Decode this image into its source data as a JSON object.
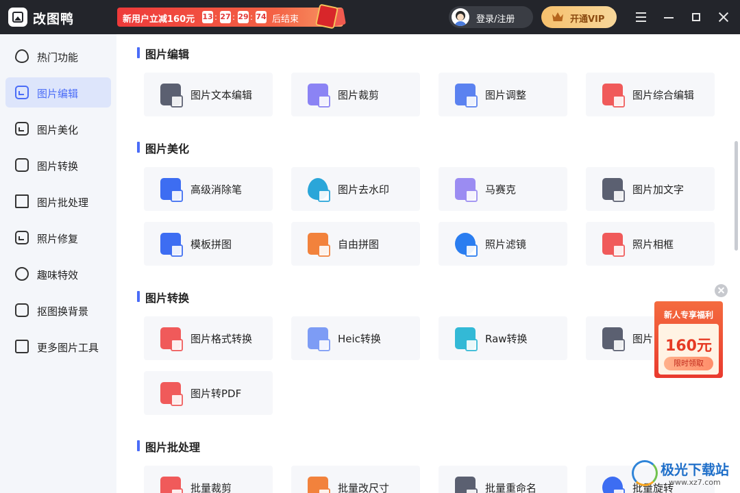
{
  "app": {
    "name": "改图鸭"
  },
  "promo": {
    "text": "新用户立减160元",
    "countdown": [
      "13",
      "27",
      "29",
      "74"
    ],
    "end_text": "后结束"
  },
  "header": {
    "login_label": "登录/注册",
    "vip_label": "开通VIP"
  },
  "sidebar": {
    "items": [
      {
        "label": "热门功能",
        "icon": "fire-icon"
      },
      {
        "label": "图片编辑",
        "icon": "image-edit-icon",
        "active": true
      },
      {
        "label": "图片美化",
        "icon": "image-beautify-icon"
      },
      {
        "label": "图片转换",
        "icon": "image-convert-icon"
      },
      {
        "label": "图片批处理",
        "icon": "batch-icon"
      },
      {
        "label": "照片修复",
        "icon": "photo-repair-icon"
      },
      {
        "label": "趣味特效",
        "icon": "magic-wand-icon"
      },
      {
        "label": "抠图换背景",
        "icon": "cutout-icon"
      },
      {
        "label": "更多图片工具",
        "icon": "toolbox-icon"
      }
    ]
  },
  "sections": [
    {
      "title": "图片编辑",
      "tools": [
        {
          "label": "图片文本编辑",
          "color": "#5b6071"
        },
        {
          "label": "图片裁剪",
          "color": "#8b83f4"
        },
        {
          "label": "图片调整",
          "color": "#5b82f0"
        },
        {
          "label": "图片综合编辑",
          "color": "#f05a5a"
        }
      ]
    },
    {
      "title": "图片美化",
      "tools": [
        {
          "label": "高级消除笔",
          "color": "#3d6df2"
        },
        {
          "label": "图片去水印",
          "color": "#2aa6d9"
        },
        {
          "label": "马赛克",
          "color": "#9b8cf2"
        },
        {
          "label": "图片加文字",
          "color": "#5b6071"
        },
        {
          "label": "模板拼图",
          "color": "#3d6df2"
        },
        {
          "label": "自由拼图",
          "color": "#f2823c"
        },
        {
          "label": "照片滤镜",
          "color": "#2a7df0"
        },
        {
          "label": "照片相框",
          "color": "#f05a5a"
        }
      ]
    },
    {
      "title": "图片转换",
      "tools": [
        {
          "label": "图片格式转换",
          "color": "#f05a5a"
        },
        {
          "label": "Heic转换",
          "color": "#7d9cf5"
        },
        {
          "label": "Raw转换",
          "color": "#33b9d6"
        },
        {
          "label": "图片",
          "color": "#5b6071"
        },
        {
          "label": "图片转PDF",
          "color": "#f05a5a"
        }
      ]
    },
    {
      "title": "图片批处理",
      "tools": [
        {
          "label": "批量裁剪",
          "color": "#f05a5a"
        },
        {
          "label": "批量改尺寸",
          "color": "#f2823c"
        },
        {
          "label": "批量重命名",
          "color": "#5b6071"
        },
        {
          "label": "批量旋转",
          "color": "#3d6df2"
        }
      ]
    }
  ],
  "bonus": {
    "title": "新人专享福利",
    "amount": "160元",
    "button": "限时领取"
  },
  "watermark": {
    "text": "极光下载站",
    "url": "www.xz7.com"
  }
}
